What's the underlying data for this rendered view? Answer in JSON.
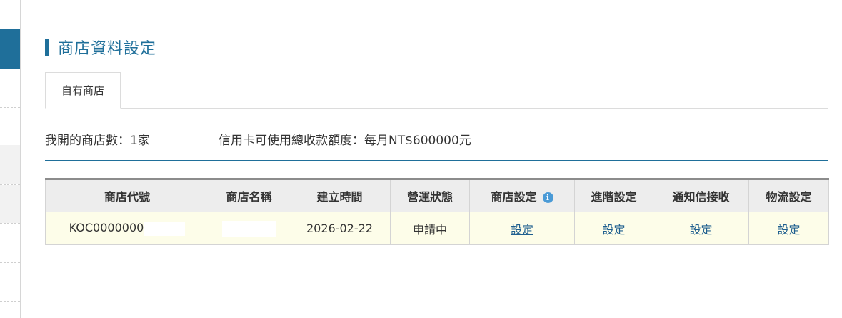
{
  "page": {
    "title": "商店資料設定",
    "accent_color": "#1f6f9a"
  },
  "tabs": [
    {
      "label": "自有商店",
      "active": true
    }
  ],
  "summary": {
    "store_count": "我開的商店數：1家",
    "credit_limit": "信用卡可使用總收款額度：每月NT$600000元"
  },
  "table": {
    "headers": [
      "商店代號",
      "商店名稱",
      "建立時間",
      "營運狀態",
      "商店設定",
      "進階設定",
      "通知信接收",
      "物流設定"
    ],
    "info_icon": "info-icon",
    "rows": [
      {
        "code": "KOC0000000",
        "name": "",
        "created": "2026-02-22",
        "status": "申請中",
        "store_setting": "設定",
        "advanced_setting": "設定",
        "notification": "設定",
        "logistics": "設定"
      }
    ]
  }
}
